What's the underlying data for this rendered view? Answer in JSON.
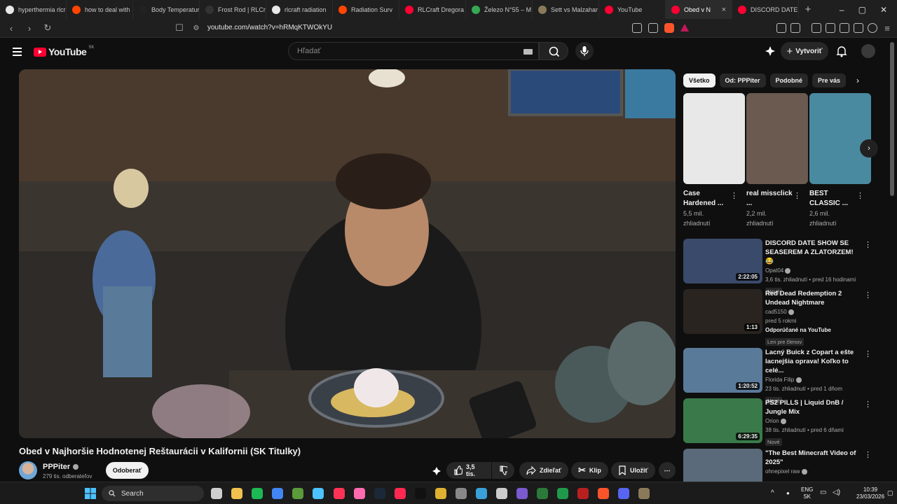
{
  "browser": {
    "tabs": [
      {
        "label": "hyperthermia rlcra",
        "color": "#e8e8e8"
      },
      {
        "label": "how to deal with",
        "color": "#ff4500"
      },
      {
        "label": "Body Temperature",
        "color": "#222222"
      },
      {
        "label": "Frost Rod | RLCra",
        "color": "#333333"
      },
      {
        "label": "rlcraft radiation",
        "color": "#e8e8e8"
      },
      {
        "label": "Radiation Surv",
        "color": "#ff4500"
      },
      {
        "label": "RLCraft Dregora",
        "color": "#ff0033"
      },
      {
        "label": "Železo N°55 – M",
        "color": "#34a853"
      },
      {
        "label": "Sett vs Malzahar",
        "color": "#8a7a5a"
      },
      {
        "label": "YouTube",
        "color": "#ff0033"
      },
      {
        "label": "Obed v N",
        "color": "#ff0033"
      },
      {
        "label": "DISCORD DATE S",
        "color": "#ff0033"
      }
    ],
    "url": "youtube.com/watch?v=hRMqKTWOkYU"
  },
  "header": {
    "logo_text": "YouTube",
    "country_code": "SK",
    "search_placeholder": "Hľadať",
    "create_label": "Vytvoriť"
  },
  "video": {
    "title": "Obed v Najhoršie Hodnotenej Reštaurácii v Kalifornii (SK Titulky)",
    "channel": "PPPiter",
    "subscribers": "279 tis. odberateľov",
    "subscribe_label": "Odoberať",
    "likes": "3,5 tis.",
    "share_label": "Zdieľať",
    "clip_label": "Klip",
    "save_label": "Uložiť"
  },
  "chips": [
    "Všetko",
    "Od: PPPiter",
    "Podobné",
    "Pre vás"
  ],
  "shorts": [
    {
      "title": "Case Hardened ...",
      "views": "5,5 mil.",
      "views_suffix": "zhliadnutí",
      "thumb": "#e8e8e8"
    },
    {
      "title": "real missclick ...",
      "views": "2,2 mil.",
      "views_suffix": "zhliadnutí",
      "thumb": "#6a5a50"
    },
    {
      "title": "BEST CLASSIC ...",
      "views": "2,6 mil.",
      "views_suffix": "zhliadnutí",
      "thumb": "#4a8aa0"
    }
  ],
  "recommendations": [
    {
      "title": "DISCORD DATE SHOW SE SEASEREM A ZLATORZEM! 😂",
      "channel": "Opat04",
      "meta": "3,6 tis. zhliadnutí • pred 16 hodinami",
      "badge": "Nové",
      "duration": "2:22:05",
      "thumb": "#3a4a6a"
    },
    {
      "title": "Red Dead Redemption 2 Undead Nightmare",
      "channel": "cad5150",
      "meta": "pred 5 rokmi",
      "extra": "Odporúčané na YouTube",
      "badge": "Len pre členov",
      "duration": "1:13",
      "thumb": "#2a2420"
    },
    {
      "title": "Lacný Buick z Copart a ešte lacnejšia oprava! Koľko to celé...",
      "channel": "Florida Filip",
      "meta": "23 tis. zhliadnutí • pred 1 dňom",
      "badge": "Nové",
      "duration": "1:20:52",
      "thumb": "#5a7a9a"
    },
    {
      "title": "PS2 PILLS | Liquid DnB / Jungle Mix",
      "channel": "Orion",
      "meta": "38 tis. zhliadnutí • pred 6 dňami",
      "badge": "Nové",
      "duration": "6:29:35",
      "thumb": "#3a7a4a"
    },
    {
      "title": "\"The Best Minecraft Video of 2025\"",
      "channel": "ohnepixel raw",
      "meta": "",
      "badge": "",
      "duration": "",
      "thumb": "#5a6a7a"
    }
  ],
  "taskbar": {
    "search_label": "Search",
    "lang": "ENG",
    "region": "SK",
    "time": "10:39",
    "date": "23/03/2026"
  }
}
